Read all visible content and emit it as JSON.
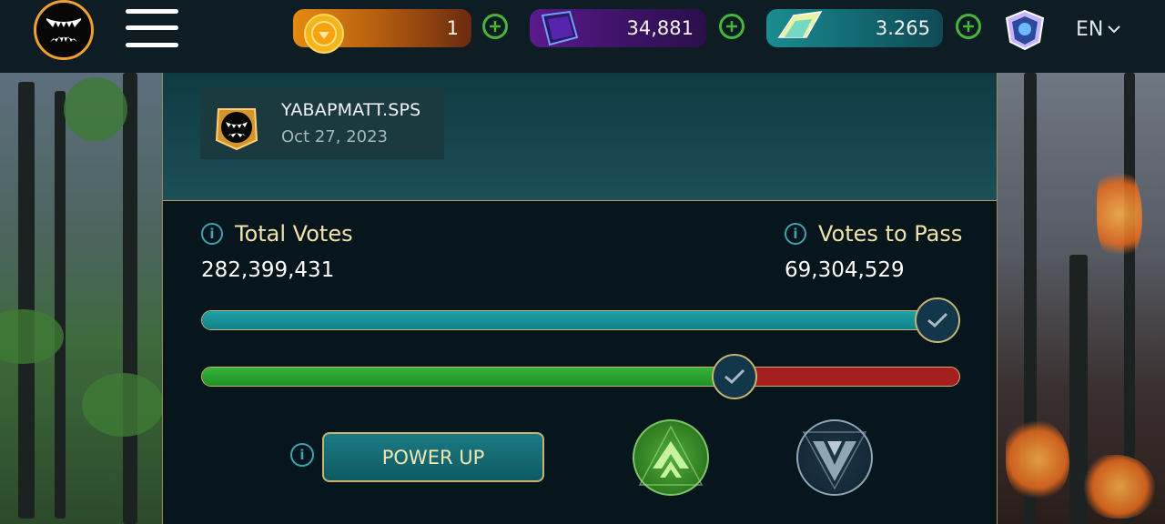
{
  "topbar": {
    "balances": [
      {
        "name": "gold-credits",
        "value": "1",
        "color": "#e48a10",
        "icon": "gold-coin-icon"
      },
      {
        "name": "dark-energy-crystals",
        "value": "34,881",
        "color": "#5a1a8c",
        "icon": "purple-crystal-icon"
      },
      {
        "name": "sps-token",
        "value": "3.265",
        "color": "#1b8c90",
        "icon": "teal-shard-icon"
      }
    ],
    "language": "EN"
  },
  "proposal": {
    "author": "YABAPMATT.SPS",
    "date": "Oct 27, 2023"
  },
  "voting": {
    "total_votes_label": "Total Votes",
    "total_votes_value": "282,399,431",
    "votes_to_pass_label": "Votes to Pass",
    "votes_to_pass_value": "69,304,529",
    "total_progress_fraction": 1.0,
    "yes_fraction": 0.703,
    "power_up_label": "POWER UP",
    "info_symbol": "i"
  },
  "colors": {
    "accent_gold": "#c8b470",
    "teal": "#1ea2a8",
    "yes_green": "#35b23a",
    "no_red": "#a51e1e"
  }
}
